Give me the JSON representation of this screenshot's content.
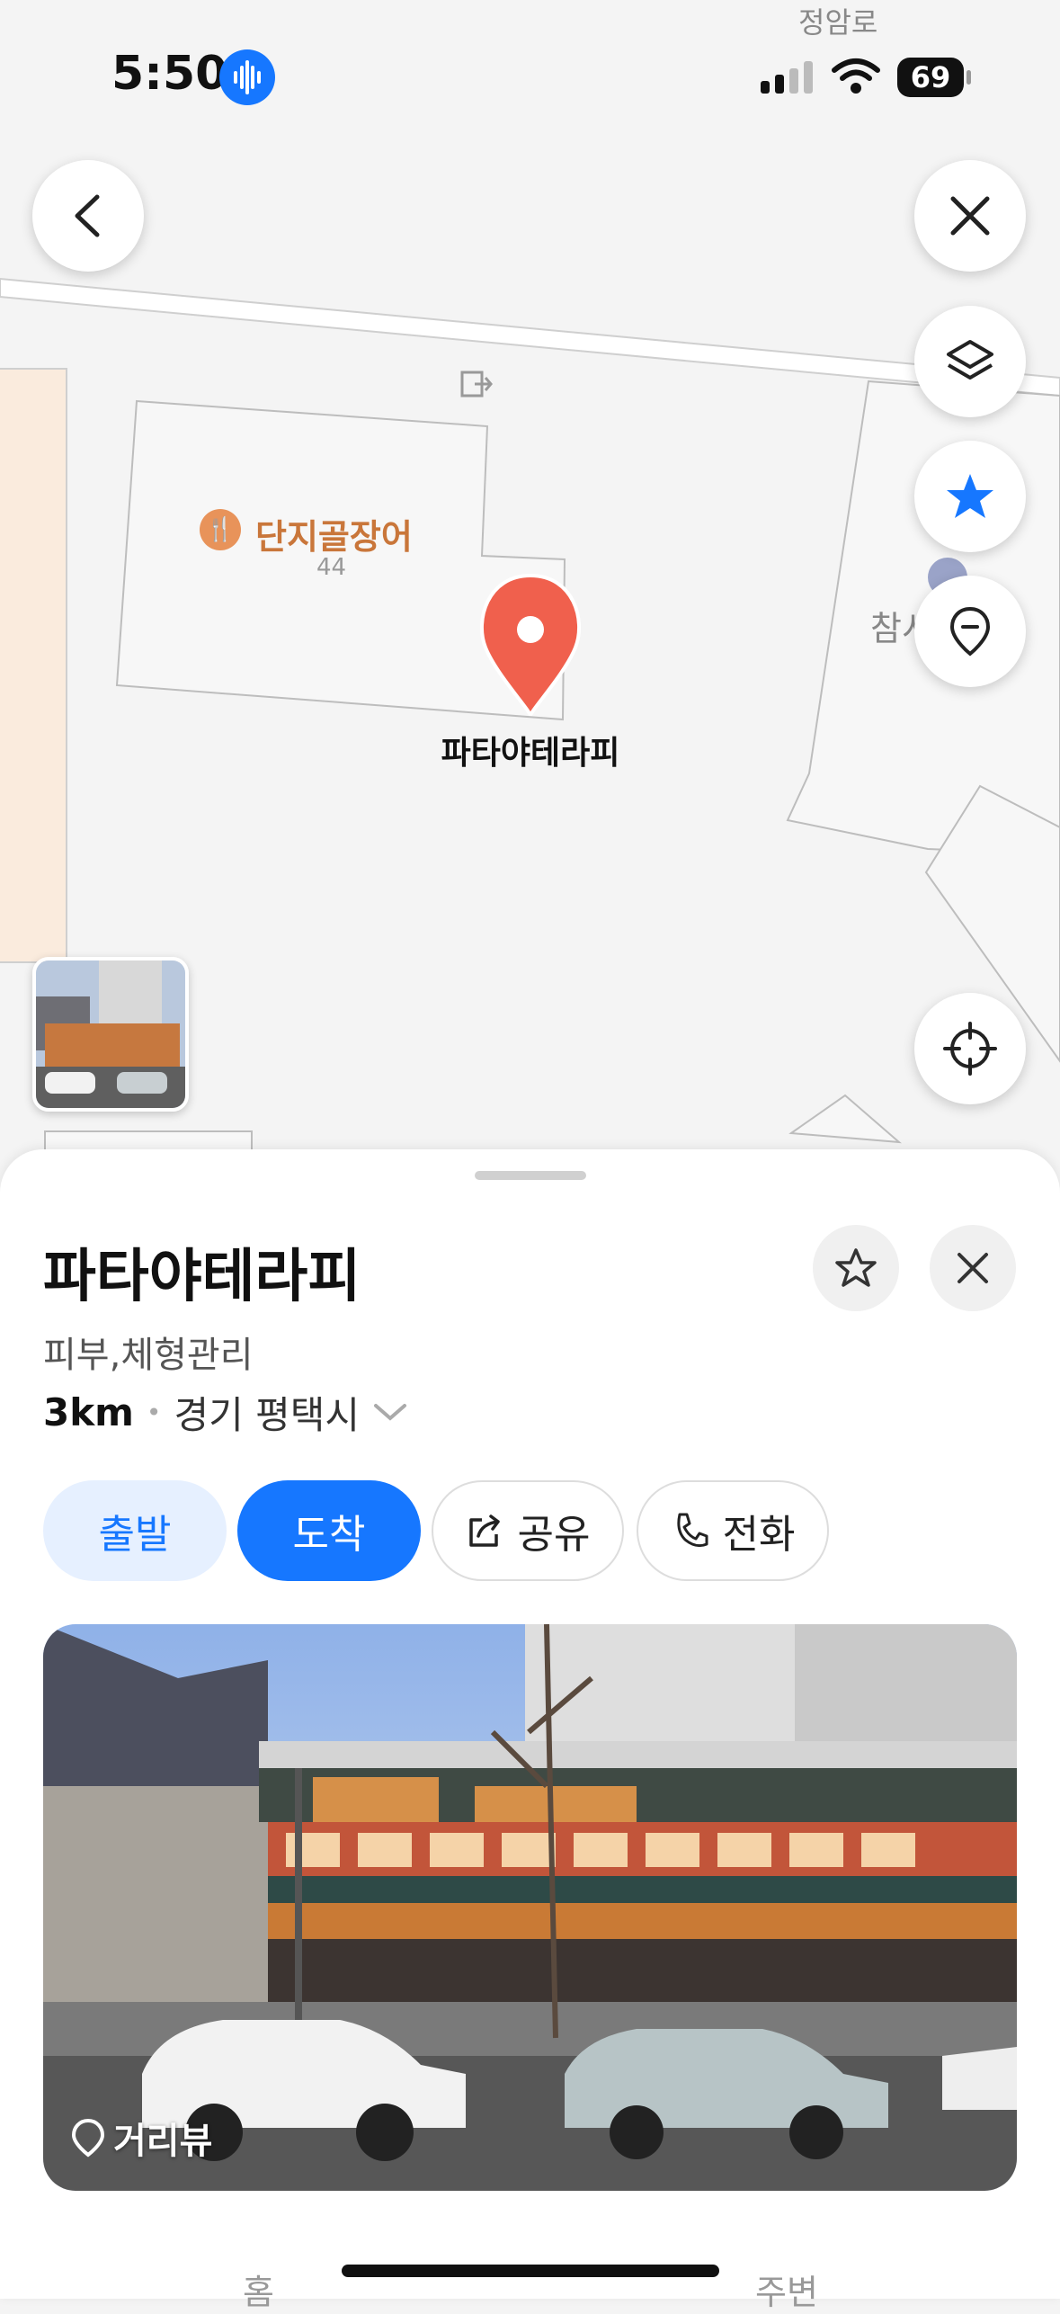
{
  "status_bar": {
    "time": "5:50",
    "battery": "69",
    "street_name": "정암로"
  },
  "map": {
    "poi_name": "단지골장어",
    "poi_number": "44",
    "pin_label": "파타야테라피",
    "side_label": "참시"
  },
  "place": {
    "name": "파타야테라피",
    "category": "피부,체형관리",
    "distance": "3km",
    "region": "경기 평택시"
  },
  "actions": {
    "depart": "출발",
    "arrive": "도착",
    "share": "공유",
    "call": "전화"
  },
  "photo": {
    "street_view_label": "거리뷰"
  },
  "tabs_peek": {
    "left": "홈",
    "right": "주변"
  },
  "colors": {
    "accent": "#1677ff",
    "pin": "#f0604d",
    "poi": "#c9763a"
  }
}
